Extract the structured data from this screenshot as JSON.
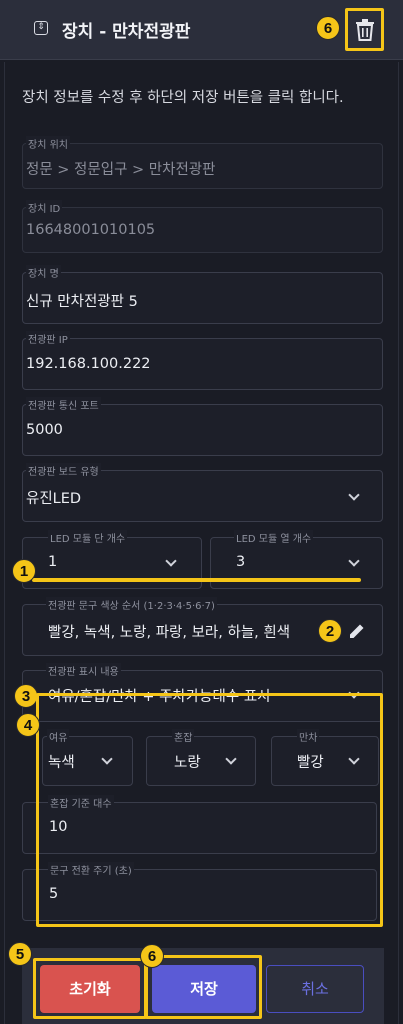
{
  "header": {
    "title": "장치 - 만차전광판",
    "icon": "sort-arrows-icon",
    "delete_icon": "trash-icon"
  },
  "description": "장치 정보를 수정 후 하단의 저장 버튼을 클릭 합니다.",
  "fields": {
    "location": {
      "label": "장치 위치",
      "value": "정문 > 정문입구 > 만차전광판"
    },
    "device_id": {
      "label": "장치 ID",
      "value": "16648001010105"
    },
    "device_name": {
      "label": "장치 명",
      "value": "신규 만차전광판 5"
    },
    "board_ip": {
      "label": "전광판 IP",
      "value": "192.168.100.222"
    },
    "board_port": {
      "label": "전광판 통신 포트",
      "value": "5000"
    },
    "board_type": {
      "label": "전광판 보드 유형",
      "value": "유진LED"
    },
    "led_rows": {
      "label": "LED 모듈 단 개수",
      "value": "1"
    },
    "led_cols": {
      "label": "LED 모듈 열 개수",
      "value": "3"
    },
    "text_color_order": {
      "label": "전광판 문구 색상 순서 (1·2·3·4·5·6·7)",
      "value": "빨강, 녹색, 노랑, 파랑, 보라, 하늘, 흰색"
    },
    "display_content": {
      "label": "전광판 표시 내용",
      "value": "여유/혼잡/만차 + 주차가능대수 표시"
    },
    "color_free": {
      "label": "여유",
      "value": "녹색"
    },
    "color_busy": {
      "label": "혼잡",
      "value": "노랑"
    },
    "color_full": {
      "label": "만차",
      "value": "빨강"
    },
    "busy_threshold": {
      "label": "혼잡 기준 대수",
      "value": "10"
    },
    "switch_period": {
      "label": "문구 전환 주기 (초)",
      "value": "5"
    }
  },
  "buttons": {
    "reset": "초기화",
    "save": "저장",
    "cancel": "취소"
  },
  "markers": [
    "1",
    "2",
    "3",
    "4",
    "5",
    "6",
    "6"
  ],
  "colors": {
    "accent": "#5b5bd6",
    "danger": "#d9534f",
    "highlight": "#f5c518"
  }
}
